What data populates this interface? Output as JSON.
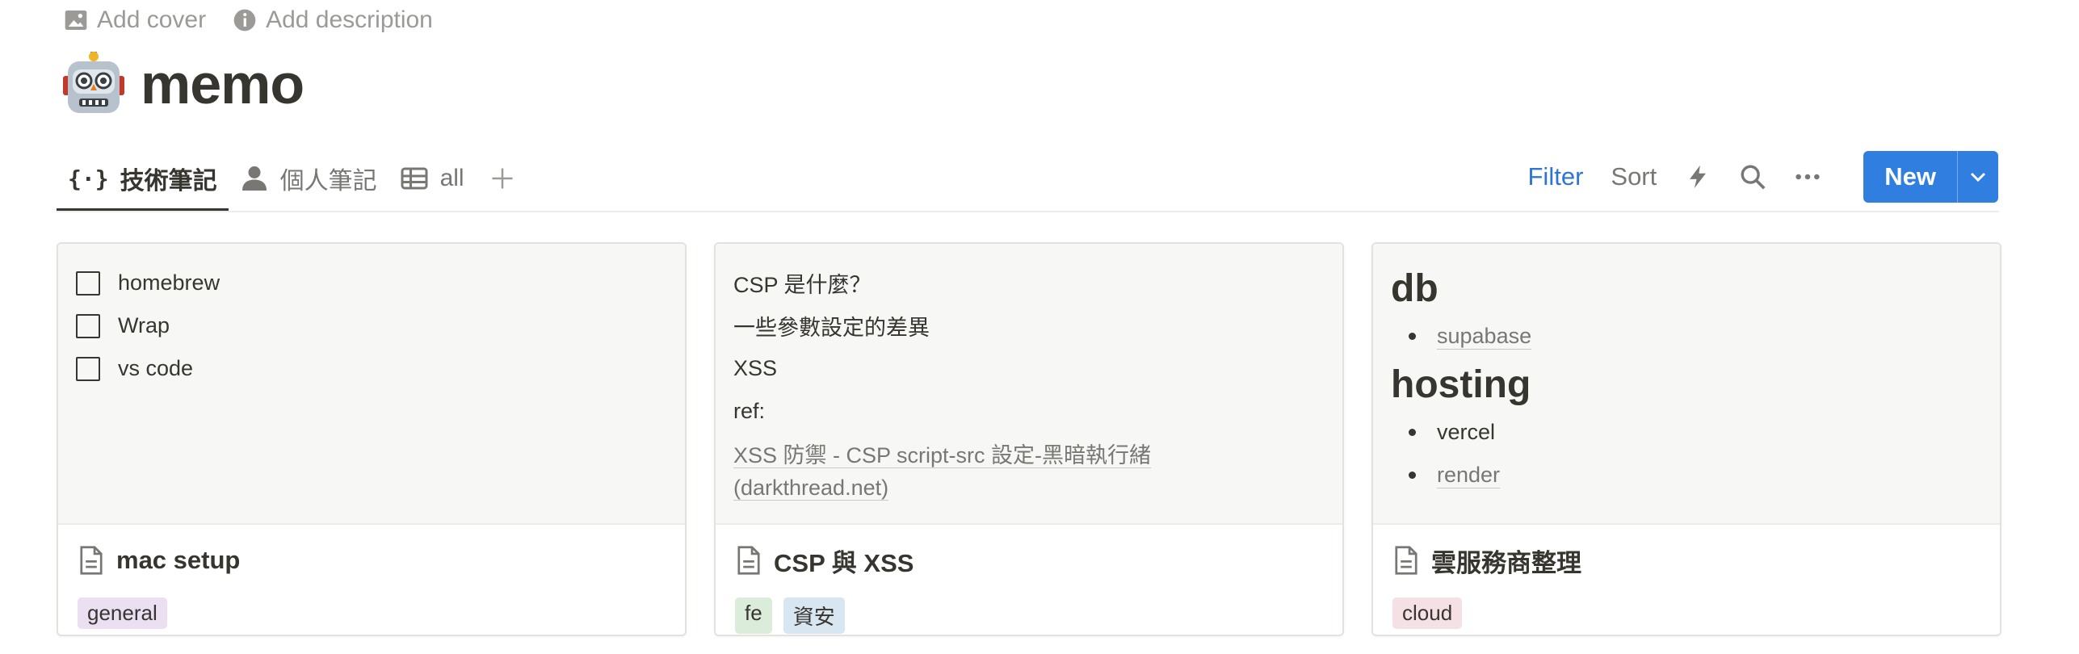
{
  "meta": {
    "add_cover": "Add cover",
    "add_description": "Add description"
  },
  "page": {
    "title": "memo",
    "icon": "robot-emoji"
  },
  "tabs": [
    {
      "label": "技術筆記",
      "icon": "curly-braces-icon",
      "active": true
    },
    {
      "label": "個人筆記",
      "icon": "person-icon",
      "active": false
    },
    {
      "label": "all",
      "icon": "table-icon",
      "active": false
    }
  ],
  "toolbar": {
    "filter": "Filter",
    "sort": "Sort",
    "new_label": "New"
  },
  "colors": {
    "accent": "#2f7ee0",
    "filter_text": "#2f76d2"
  },
  "cards": [
    {
      "title": "mac setup",
      "checklist": [
        "homebrew",
        "Wrap",
        "vs code"
      ],
      "tags": [
        {
          "label": "general",
          "color": "#ebdff2"
        }
      ]
    },
    {
      "title": "CSP 與 XSS",
      "lines": [
        "CSP 是什麼？",
        "一些參數設定的差異",
        "XSS",
        "ref:"
      ],
      "link": "XSS 防禦 - CSP script-src 設定-黑暗執行緒 (darkthread.net)",
      "tags": [
        {
          "label": "fe",
          "color": "#dcecdb"
        },
        {
          "label": "資安",
          "color": "#d8e6f2"
        }
      ]
    },
    {
      "title": "雲服務商整理",
      "sections": [
        {
          "heading": "db",
          "items": [
            {
              "text": "supabase",
              "link": true
            }
          ]
        },
        {
          "heading": "hosting",
          "items": [
            {
              "text": "vercel",
              "link": false
            },
            {
              "text": "render",
              "link": true
            }
          ]
        }
      ],
      "tags": [
        {
          "label": "cloud",
          "color": "#f5e0e6"
        }
      ]
    }
  ]
}
